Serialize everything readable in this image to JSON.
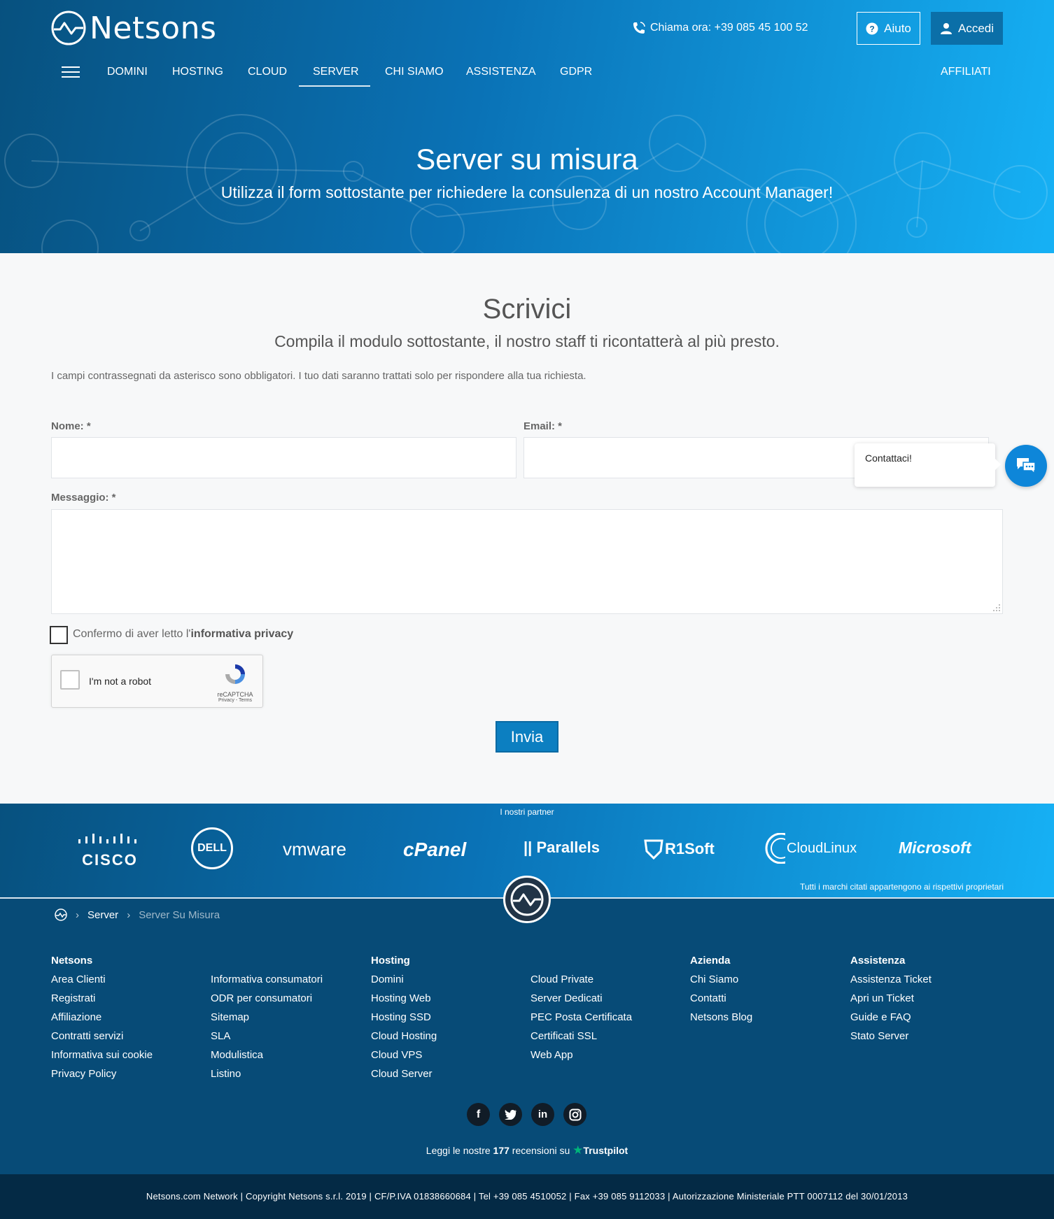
{
  "header": {
    "logo_text": "Netsons",
    "phone_text": "Chiama ora: +39 085 45 100 52",
    "help_label": "Aiuto",
    "login_label": "Accedi",
    "nav": [
      "DOMINI",
      "HOSTING",
      "CLOUD",
      "SERVER",
      "CHI SIAMO",
      "ASSISTENZA",
      "GDPR"
    ],
    "nav_right": "AFFILIATI",
    "active_nav": "SERVER"
  },
  "hero": {
    "title": "Server su misura",
    "subtitle": "Utilizza il form sottostante per richiedere la consulenza di un nostro Account Manager!"
  },
  "form": {
    "title": "Scrivici",
    "subtitle": "Compila il modulo sottostante, il nostro staff ti ricontatterà al più presto.",
    "note": "I campi contrassegnati da asterisco sono obbligatori. I tuo dati saranno trattati solo per rispondere alla tua richiesta.",
    "name_label": "Nome: *",
    "email_label": "Email: *",
    "message_label": "Messaggio: *",
    "name_value": "",
    "email_value": "",
    "message_value": "",
    "privacy_prefix": "Confermo di aver letto l'",
    "privacy_link": "informativa privacy",
    "captcha_text": "I'm not a robot",
    "captcha_brand": "reCAPTCHA",
    "captcha_links": "Privacy - Terms",
    "submit_label": "Invia"
  },
  "chat": {
    "popup_text": "Contattaci!"
  },
  "partners": {
    "title": "I nostri partner",
    "logos": [
      "CISCO",
      "DELL",
      "vmware",
      "cPanel",
      "Parallels",
      "R1Soft",
      "CloudLinux",
      "Microsoft"
    ],
    "disclaimer": "Tutti i marchi citati appartengono ai rispettivi proprietari"
  },
  "breadcrumb": {
    "items": [
      "Server",
      "Server Su Misura"
    ]
  },
  "footer": {
    "columns": [
      {
        "head": "Netsons",
        "links": [
          "Area Clienti",
          "Registrati",
          "Affiliazione",
          "Contratti servizi",
          "Informativa sui cookie",
          "Privacy Policy"
        ]
      },
      {
        "head": "",
        "links": [
          "Informativa consumatori",
          "ODR per consumatori",
          "Sitemap",
          "SLA",
          "Modulistica",
          "Listino"
        ]
      },
      {
        "head": "Hosting",
        "links": [
          "Domini",
          "Hosting Web",
          "Hosting SSD",
          "Cloud Hosting",
          "Cloud VPS",
          "Cloud Server"
        ]
      },
      {
        "head": "",
        "links": [
          "Cloud Private",
          "Server Dedicati",
          "PEC Posta Certificata",
          "Certificati SSL",
          "Web App"
        ]
      },
      {
        "head": "Azienda",
        "links": [
          "Chi Siamo",
          "Contatti",
          "Netsons Blog"
        ]
      },
      {
        "head": "Assistenza",
        "links": [
          "Assistenza Ticket",
          "Apri un Ticket",
          "Guide e FAQ",
          "Stato Server"
        ]
      }
    ],
    "social": [
      "f",
      "t",
      "in",
      "ig"
    ],
    "trust_prefix": "Leggi le nostre",
    "trust_count": "177",
    "trust_suffix": "recensioni su",
    "trust_brand": "Trustpilot",
    "copyright": "Netsons.com Network | Copyright Netsons s.r.l. 2019 | CF/P.IVA 01838660684 | Tel +39 085 4510052 | Fax +39 085 9112033 | Autorizzazione Ministeriale PTT 0007112 del 30/01/2013"
  },
  "colors": {
    "brand_dark": "#07517f",
    "brand_light": "#16b1f5",
    "submit": "#0c7fc1",
    "footer": "#074b77",
    "copyright_bar": "#042a45"
  }
}
